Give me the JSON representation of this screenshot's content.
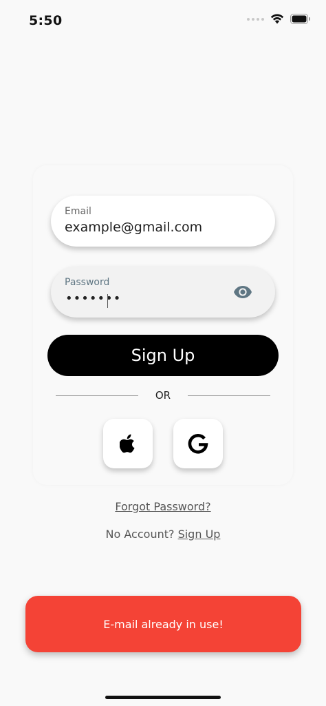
{
  "status_bar": {
    "time": "5:50"
  },
  "form": {
    "email": {
      "label": "Email",
      "value": "example@gmail.com"
    },
    "password": {
      "label": "Password",
      "masked_value": "•••••••",
      "toggle_icon": "eye-icon"
    },
    "submit_label": "Sign Up",
    "divider_text": "OR",
    "social": [
      {
        "name": "apple",
        "icon": "apple-icon"
      },
      {
        "name": "google",
        "icon": "google-icon"
      }
    ]
  },
  "links": {
    "forgot_password": "Forgot Password?",
    "no_account_prefix": "No Account?",
    "sign_up": "Sign Up"
  },
  "snackbar": {
    "message": "E-mail already in use!",
    "color": "#f44336"
  }
}
